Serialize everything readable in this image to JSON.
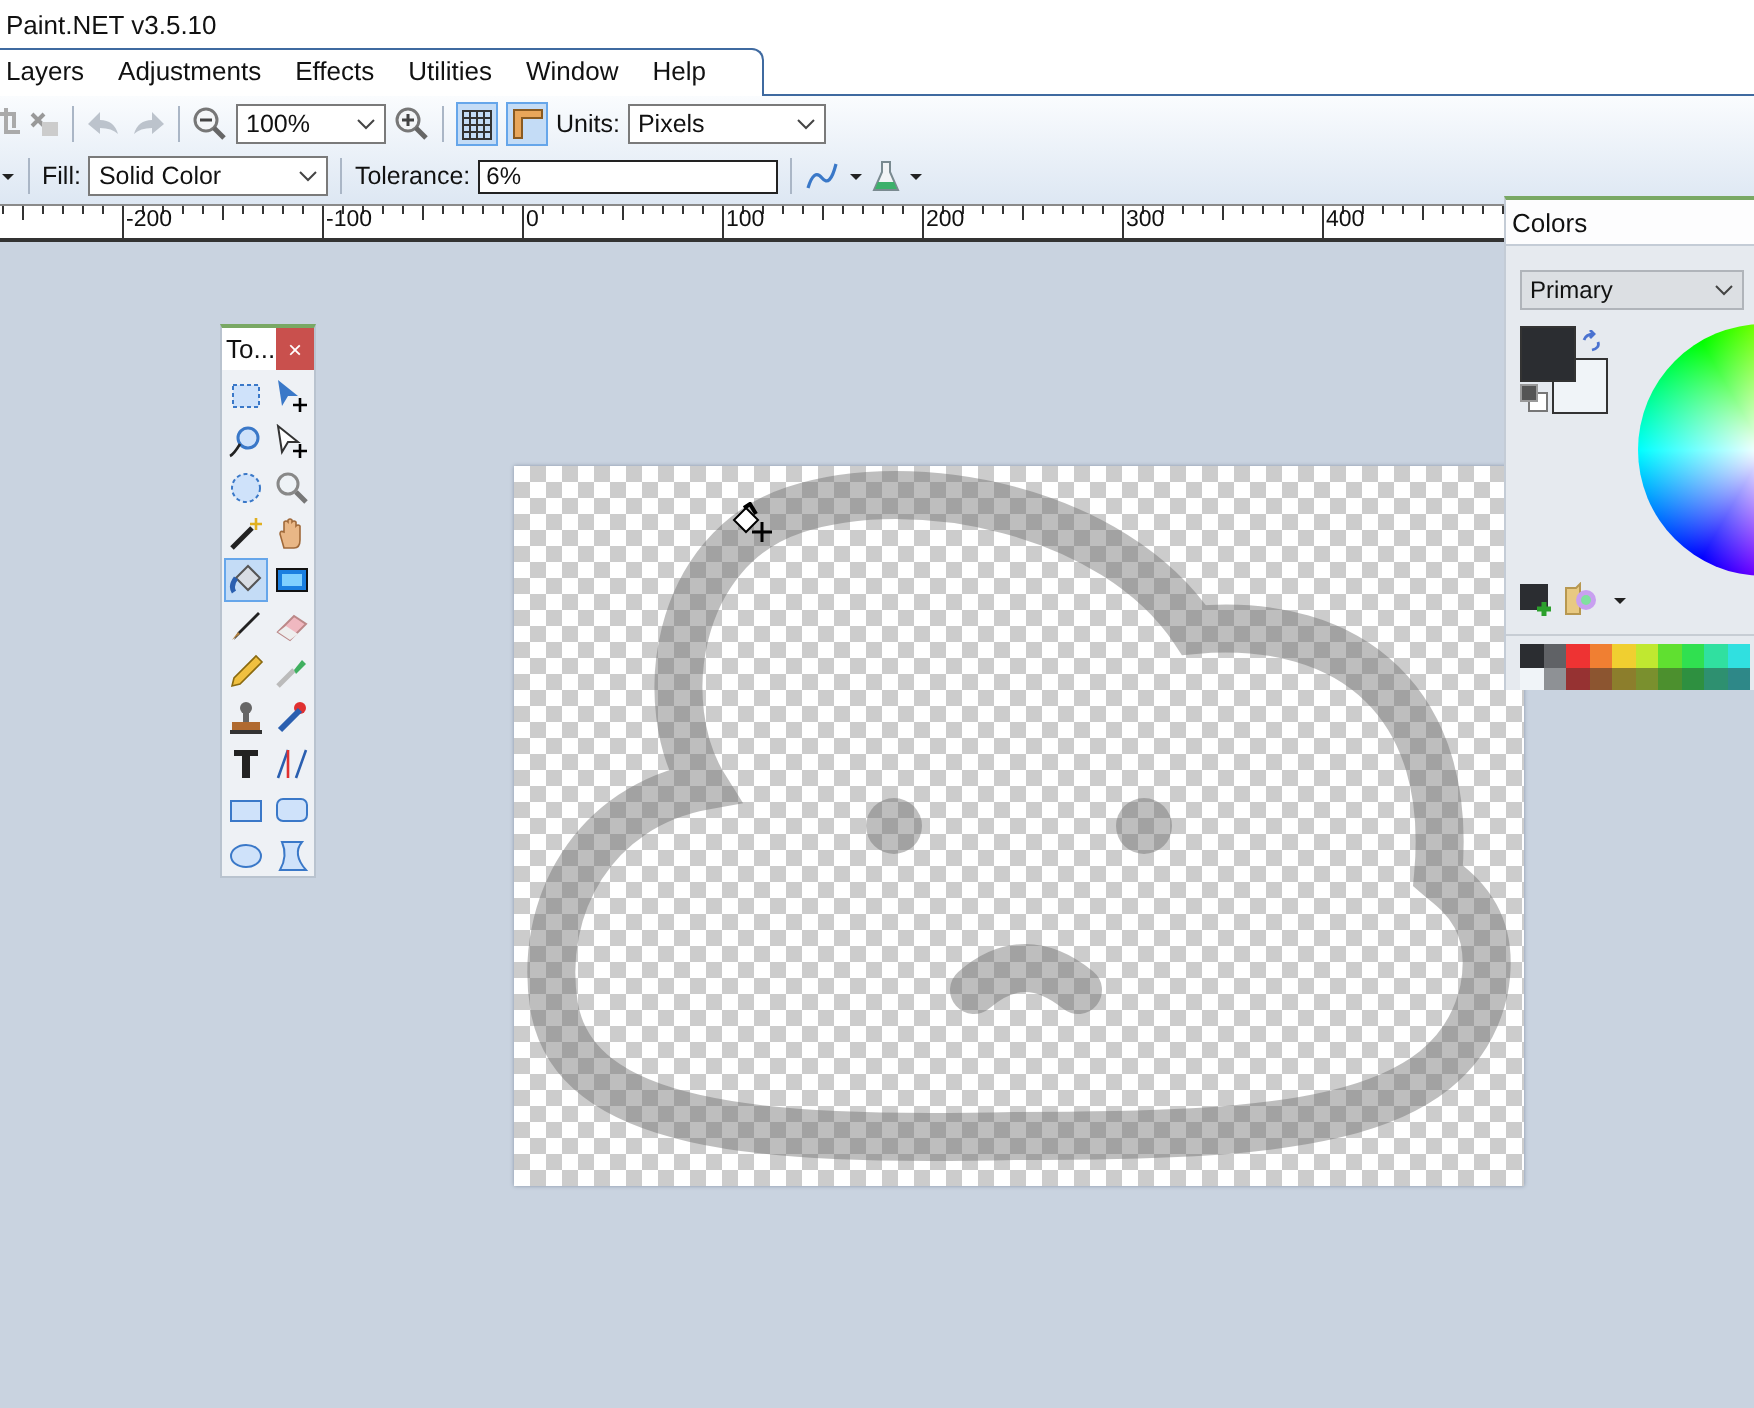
{
  "window": {
    "title": "Paint.NET v3.5.10"
  },
  "menu": [
    "Layers",
    "Adjustments",
    "Effects",
    "Utilities",
    "Window",
    "Help"
  ],
  "toolbar": {
    "zoom": "100%",
    "grid_selected": true,
    "rulers_selected": true,
    "units_label": "Units:",
    "units": "Pixels"
  },
  "tool_options": {
    "fill_label": "Fill:",
    "fill": "Solid Color",
    "tolerance_label": "Tolerance:",
    "tolerance": "6%"
  },
  "ruler": {
    "labels": [
      "-200",
      "-100",
      "0",
      "100",
      "200",
      "300",
      "400"
    ]
  },
  "tools_window": {
    "title": "To...",
    "close": "×",
    "tools": [
      {
        "selected": false
      },
      {
        "selected": false
      },
      {
        "selected": false
      },
      {
        "selected": false
      },
      {
        "selected": false
      },
      {
        "selected": false
      },
      {
        "selected": false
      },
      {
        "selected": false
      },
      {
        "selected": true
      },
      {
        "selected": false
      },
      {
        "selected": false
      },
      {
        "selected": false
      },
      {
        "selected": false
      },
      {
        "selected": false
      },
      {
        "selected": false
      },
      {
        "selected": false
      },
      {
        "selected": false
      },
      {
        "selected": false
      },
      {
        "selected": false
      },
      {
        "selected": false
      },
      {
        "selected": false
      },
      {
        "selected": false
      }
    ]
  },
  "colors_window": {
    "title": "Colors",
    "mode": "Primary",
    "swatches": [
      {
        "kind": "primary",
        "color": "#2b2d31"
      },
      {
        "kind": "secondary",
        "color": "#f0f4f8"
      }
    ],
    "palette": [
      {
        "color": "#2b2d31"
      },
      {
        "color": "#606266"
      },
      {
        "color": "#ee3333"
      },
      {
        "color": "#f07f32"
      },
      {
        "color": "#f0cf30"
      },
      {
        "color": "#c0e830"
      },
      {
        "color": "#60e030"
      },
      {
        "color": "#30e050"
      },
      {
        "color": "#30e0a0"
      },
      {
        "color": "#30e0e0"
      },
      {
        "color": "#f0f4f8"
      },
      {
        "color": "#8e9195"
      },
      {
        "color": "#963232"
      },
      {
        "color": "#8c5530"
      },
      {
        "color": "#8c7e2c"
      },
      {
        "color": "#7a902e"
      },
      {
        "color": "#4c902e"
      },
      {
        "color": "#2e9040"
      },
      {
        "color": "#2e9070"
      },
      {
        "color": "#2e8888"
      }
    ]
  }
}
